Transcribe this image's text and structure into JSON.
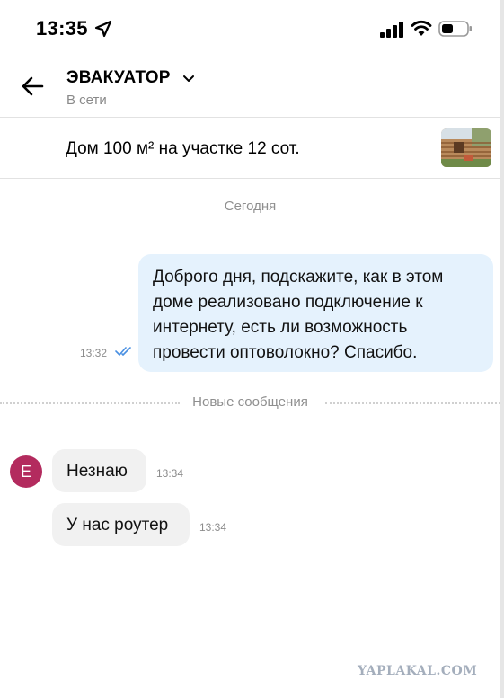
{
  "status_bar": {
    "time": "13:35"
  },
  "header": {
    "title": "ЭВАКУАТОР",
    "status": "В сети"
  },
  "listing": {
    "title": "Дом 100 м² на участке 12 сот."
  },
  "chat": {
    "date_separator": "Сегодня",
    "outgoing": [
      {
        "lines": [
          "Доброго дня, подскажите, как в этом",
          "доме реализовано подключение к",
          "интернету, есть ли возможность",
          "провести оптоволокно? Спасибо."
        ],
        "time": "13:32"
      }
    ],
    "new_messages_label": "Новые сообщения",
    "sender_initial": "E",
    "incoming": [
      {
        "text": "Незнаю",
        "time": "13:34"
      },
      {
        "text": "У нас роутер",
        "time": "13:34"
      }
    ]
  },
  "watermark": "YAPLAKAL.COM",
  "colors": {
    "outgoing_bubble": "#e5f2fd",
    "incoming_bubble": "#f1f1f1",
    "avatar": "#b32b5e",
    "read_ticks": "#4a90e2"
  }
}
